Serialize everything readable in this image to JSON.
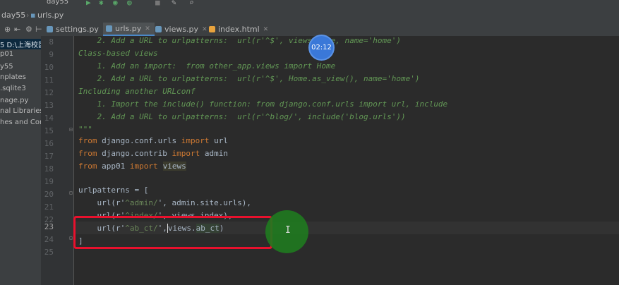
{
  "toolbar": {
    "project_selector": "day55"
  },
  "breadcrumb": {
    "project": "day55",
    "file": "urls.py"
  },
  "tabs": [
    {
      "label": "settings.py"
    },
    {
      "label": "urls.py"
    },
    {
      "label": "views.py"
    },
    {
      "label": "index.html"
    }
  ],
  "sidebar": {
    "items": [
      {
        "label": "5 D:\\上海校区"
      },
      {
        "label": "p01"
      },
      {
        "label": "y55"
      },
      {
        "label": "nplates"
      },
      {
        "label": ".sqlite3"
      },
      {
        "label": "nage.py"
      },
      {
        "label": "nal Libraries"
      },
      {
        "label": "hes and Cons"
      }
    ]
  },
  "timer": "02:12",
  "editor": {
    "line_numbers": [
      "8",
      "9",
      "10",
      "11",
      "12",
      "13",
      "14",
      "15",
      "16",
      "17",
      "18",
      "19",
      "20",
      "21",
      "22",
      "23",
      "24",
      "25"
    ],
    "current_line": "23",
    "lines": {
      "l8": "    2. Add a URL to urlpatterns:  url(r'^$', views.home, name='home')",
      "l9": "Class-based views",
      "l10": "    1. Add an import:  from other_app.views import Home",
      "l11": "    2. Add a URL to urlpatterns:  url(r'^$', Home.as_view(), name='home')",
      "l12": "Including another URLconf",
      "l13": "    1. Import the include() function: from django.conf.urls import url, include",
      "l14": "    2. Add a URL to urlpatterns:  url(r'^blog/', include('blog.urls'))",
      "l15": "\"\"\"",
      "l16_kw1": "from",
      "l16_mod": " django.conf.urls ",
      "l16_kw2": "import",
      "l16_name": " url",
      "l17_kw1": "from",
      "l17_mod": " django.contrib ",
      "l17_kw2": "import",
      "l17_name": " admin",
      "l18_kw1": "from",
      "l18_mod": " app01 ",
      "l18_kw2": "import",
      "l18_name": "views",
      "l20": "urlpatterns = [",
      "l21_pre": "    url(r'",
      "l21_str": "^admin/",
      "l21_post": "', admin.site.urls),",
      "l22_pre": "    url(r'",
      "l22_str": "^index/",
      "l22_post": "', views.index),",
      "l23_pre": "    url(r'",
      "l23_str": "^ab_ct/",
      "l23_mid": "',",
      "l23_views": "views.",
      "l23_fn": "ab_ct",
      "l23_end": ")",
      "l24": "]"
    }
  }
}
